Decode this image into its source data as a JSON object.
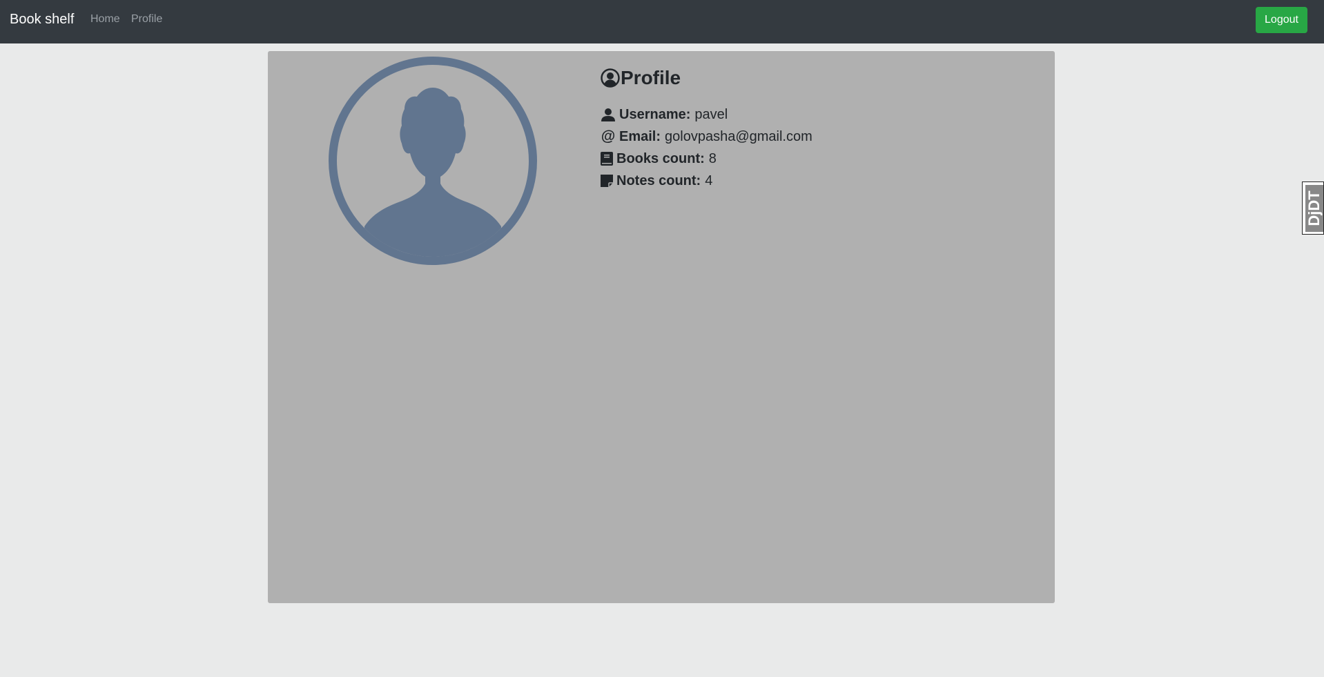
{
  "navbar": {
    "brand": "Book shelf",
    "links": [
      {
        "label": "Home"
      },
      {
        "label": "Profile"
      }
    ],
    "logout_label": "Logout"
  },
  "profile": {
    "title": "Profile",
    "fields": {
      "username": {
        "label": "Username:",
        "value": "pavel"
      },
      "email": {
        "label": "Email:",
        "value": "golovpasha@gmail.com"
      },
      "books": {
        "label": "Books count:",
        "value": "8"
      },
      "notes": {
        "label": "Notes count:",
        "value": "4"
      }
    }
  },
  "debug_toolbar": {
    "label": "DjDT"
  },
  "colors": {
    "navbar_bg": "#343a40",
    "logout_bg": "#28a745",
    "card_bg": "#b0b0b0",
    "avatar": "#61758f",
    "page_bg": "#e9eaea"
  },
  "icons": {
    "title": "user-circle-icon",
    "username": "user-icon",
    "email": "at-icon",
    "books": "book-icon",
    "notes": "sticky-note-icon",
    "avatar": "avatar-silhouette-icon"
  }
}
